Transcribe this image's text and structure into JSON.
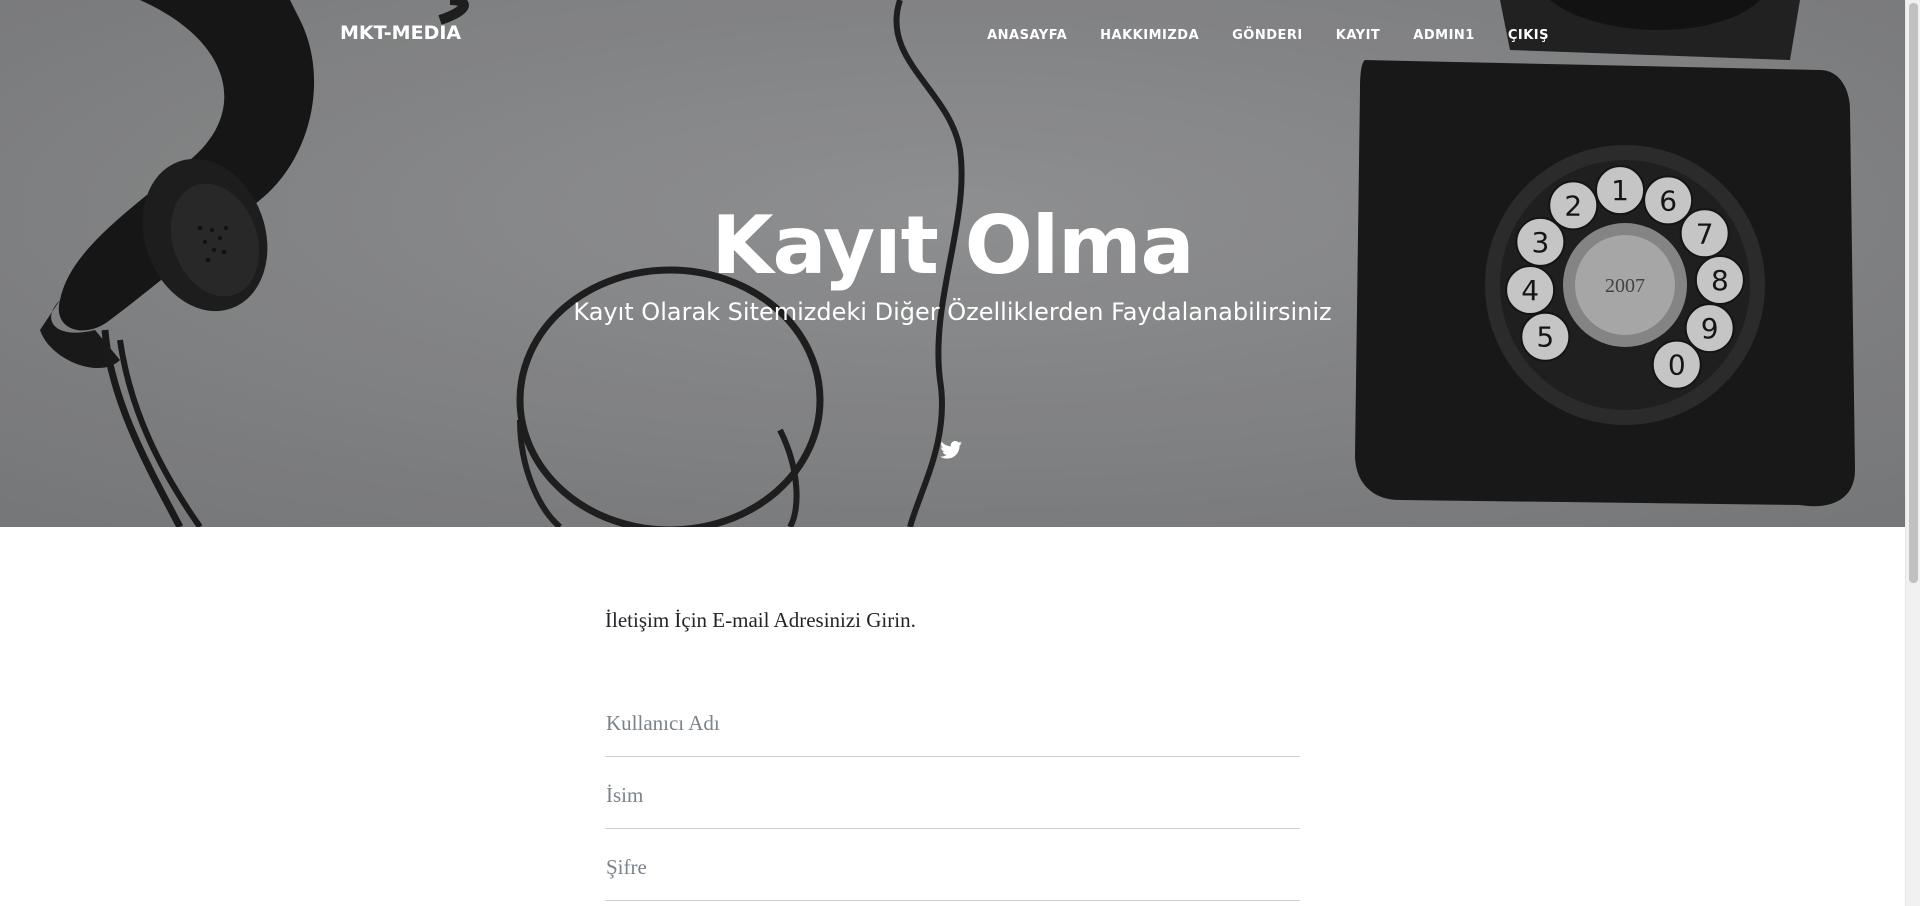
{
  "navbar": {
    "brand": "MKT-MEDIA",
    "links": [
      {
        "label": "ANASAYFA"
      },
      {
        "label": "HAKKIMIZDA"
      },
      {
        "label": "GÖNDERI"
      },
      {
        "label": "KAYIT"
      },
      {
        "label": "ADMIN1"
      },
      {
        "label": "ÇIKIŞ"
      }
    ]
  },
  "hero": {
    "title": "Kayıt Olma",
    "subtitle": "Kayıt Olarak Sitemizdeki Diğer Özelliklerden Faydalanabilirsiniz",
    "social_icon": "twitter-icon",
    "phone_dial_digits": [
      "5",
      "4",
      "3",
      "2",
      "1",
      "6",
      "7",
      "8",
      "9",
      "0"
    ],
    "dial_center_text": "2007"
  },
  "form": {
    "intro": "İletişim İçin E-mail Adresinizi Girin.",
    "fields": [
      {
        "placeholder": "Kullanıcı Adı",
        "value": ""
      },
      {
        "placeholder": "İsim",
        "value": ""
      },
      {
        "placeholder": "Şifre",
        "value": ""
      }
    ]
  },
  "colors": {
    "hero_background": "#8a8b8d",
    "text_dark": "#212529",
    "placeholder": "#7a838b",
    "field_border": "#cfcfcf"
  }
}
